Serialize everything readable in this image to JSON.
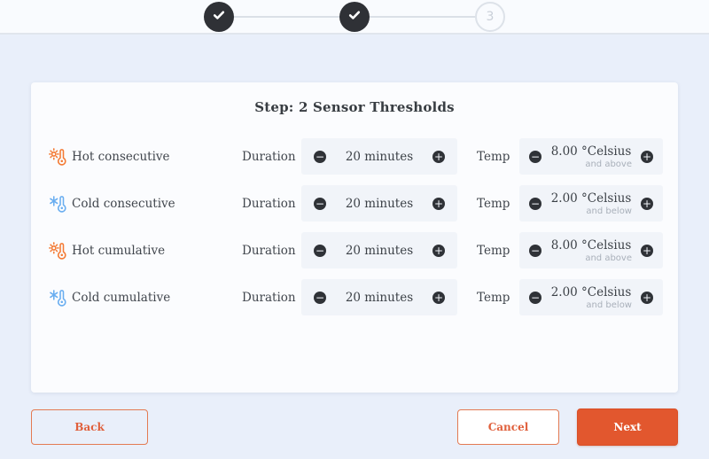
{
  "stepper": {
    "steps": [
      {
        "state": "completed",
        "label": ""
      },
      {
        "state": "completed",
        "label": ""
      },
      {
        "state": "upcoming",
        "label": "3"
      }
    ]
  },
  "card": {
    "title": "Step: 2 Sensor Thresholds",
    "duration_label": "Duration",
    "temp_label": "Temp",
    "rows": [
      {
        "icon": "thermometer-sun-icon",
        "label": "Hot consecutive",
        "duration_value": "20 minutes",
        "temp_value": "8.00 °Celsius",
        "temp_note": "and above"
      },
      {
        "icon": "thermometer-snowflake-icon",
        "label": "Cold consecutive",
        "duration_value": "20 minutes",
        "temp_value": "2.00 °Celsius",
        "temp_note": "and below"
      },
      {
        "icon": "thermometer-sun-icon",
        "label": "Hot cumulative",
        "duration_value": "20 minutes",
        "temp_value": "8.00 °Celsius",
        "temp_note": "and above"
      },
      {
        "icon": "thermometer-snowflake-icon",
        "label": "Cold cumulative",
        "duration_value": "20 minutes",
        "temp_value": "2.00 °Celsius",
        "temp_note": "and below"
      }
    ]
  },
  "footer": {
    "back_label": "Back",
    "cancel_label": "Cancel",
    "next_label": "Next"
  },
  "colors": {
    "accent_orange": "#e2572e",
    "hot_icon": "#f47b35",
    "cold_icon": "#6aaef0",
    "step_dark": "#2f3136",
    "panel_bg": "#f1f4f9",
    "page_bg": "#e9effa"
  }
}
